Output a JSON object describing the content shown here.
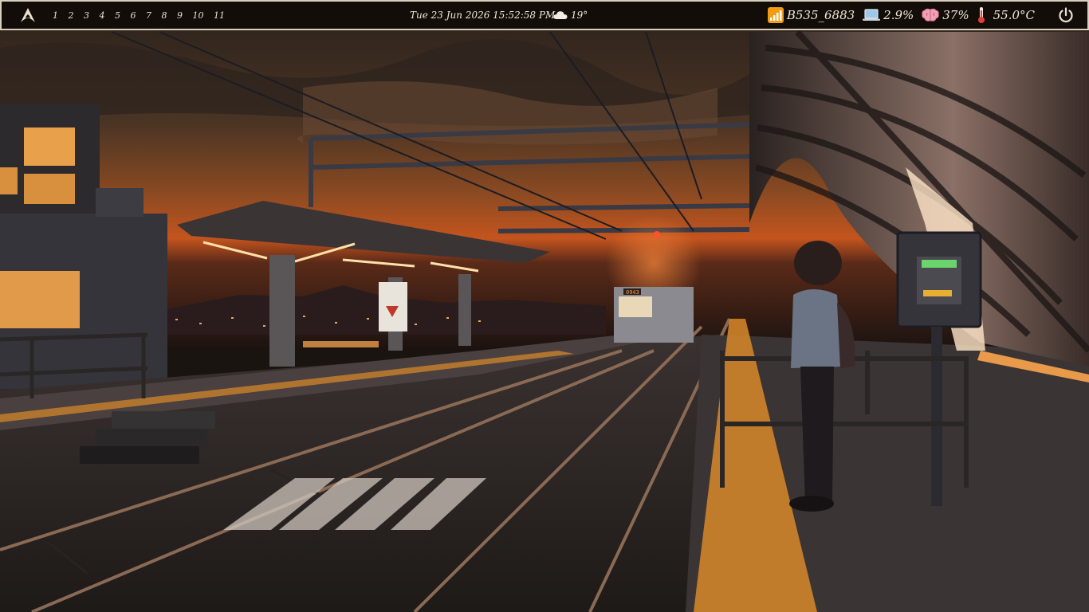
{
  "topbar": {
    "logo_icon": "arch-linux-icon",
    "workspaces": [
      "1",
      "2",
      "3",
      "4",
      "5",
      "6",
      "7",
      "8",
      "9",
      "10",
      "11"
    ],
    "clock": "Tue 23 Jun 2026 15:52:58 PM",
    "weather": {
      "icon": "cloud-icon",
      "temp": "19°"
    },
    "wifi": {
      "icon": "wifi-signal-icon",
      "ssid": "B535_6883",
      "color": "#f39c12"
    },
    "cpu": {
      "icon": "laptop-icon",
      "value": "2.9%"
    },
    "memory": {
      "icon": "brain-icon",
      "value": "37%"
    },
    "temperature": {
      "icon": "thermometer-icon",
      "value": "55.0°C"
    },
    "power_icon": "power-icon"
  },
  "wallpaper": {
    "description_colors": {
      "sky": "#3a2a1e",
      "sunset": "#c4541e",
      "light": "#ffb84d"
    },
    "train_sign": "0943"
  }
}
